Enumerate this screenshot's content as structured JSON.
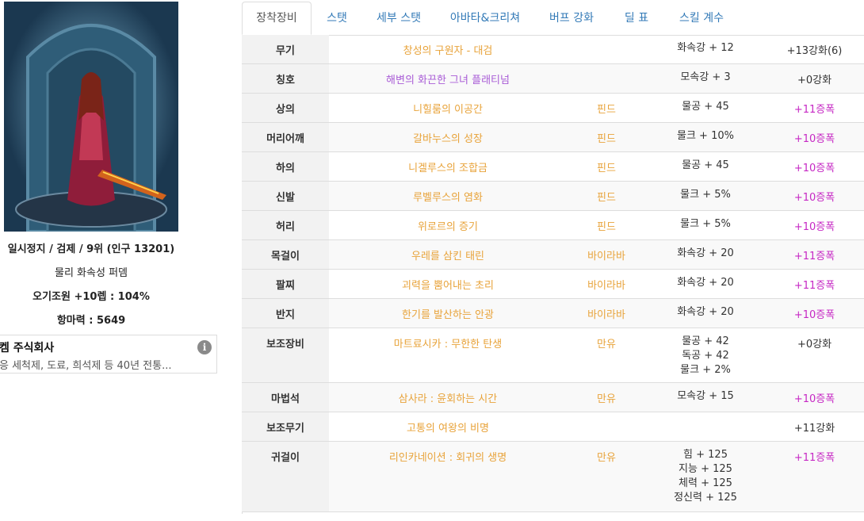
{
  "character": {
    "status_line": "일시정지 / 검제 / 9위 (인구 13201)",
    "element_line": "물리 화속성 퍼뎀",
    "buff_line": "오기조원 +10렙 : 104%",
    "resist_line": "항마력 : 5649"
  },
  "ad": {
    "title": "켐 주식회사",
    "description": "응 세척제, 도료, 희석제 등 40년 전통...",
    "info_icon": "i"
  },
  "tabs": [
    "장착장비",
    "스탯",
    "세부 스탯",
    "아바타&크리쳐",
    "버프 강화",
    "딜 표",
    "스킬 계수"
  ],
  "equipment": [
    {
      "slot": "무기",
      "name": "창성의 구원자 - 대검",
      "name_color": "orange",
      "grade": "",
      "stats": [
        "화속강 + 12"
      ],
      "upgrade": "+13강화(6)",
      "amp": false
    },
    {
      "slot": "칭호",
      "name": "해변의 화끈한 그녀 플래티넘",
      "name_color": "purple",
      "grade": "",
      "stats": [
        "모속강 + 3"
      ],
      "upgrade": "+0강화",
      "amp": false
    },
    {
      "slot": "상의",
      "name": "니힐룸의 이공간",
      "name_color": "orange",
      "grade": "핀드",
      "stats": [
        "물공 + 45"
      ],
      "upgrade": "+11증폭",
      "amp": true
    },
    {
      "slot": "머리어깨",
      "name": "갈바누스의 성장",
      "name_color": "orange",
      "grade": "핀드",
      "stats": [
        "물크 + 10%"
      ],
      "upgrade": "+10증폭",
      "amp": true
    },
    {
      "slot": "하의",
      "name": "니겔루스의 조합금",
      "name_color": "orange",
      "grade": "핀드",
      "stats": [
        "물공 + 45"
      ],
      "upgrade": "+10증폭",
      "amp": true
    },
    {
      "slot": "신발",
      "name": "루벨루스의 염화",
      "name_color": "orange",
      "grade": "핀드",
      "stats": [
        "물크 + 5%"
      ],
      "upgrade": "+10증폭",
      "amp": true
    },
    {
      "slot": "허리",
      "name": "위로르의 증기",
      "name_color": "orange",
      "grade": "핀드",
      "stats": [
        "물크 + 5%"
      ],
      "upgrade": "+10증폭",
      "amp": true
    },
    {
      "slot": "목걸이",
      "name": "우레를 삼킨 태린",
      "name_color": "orange",
      "grade": "바이라바",
      "stats": [
        "화속강 + 20"
      ],
      "upgrade": "+11증폭",
      "amp": true
    },
    {
      "slot": "팔찌",
      "name": "괴력을 뿜어내는 초리",
      "name_color": "orange",
      "grade": "바이라바",
      "stats": [
        "화속강 + 20"
      ],
      "upgrade": "+11증폭",
      "amp": true
    },
    {
      "slot": "반지",
      "name": "한기를 발산하는 안광",
      "name_color": "orange",
      "grade": "바이라바",
      "stats": [
        "화속강 + 20"
      ],
      "upgrade": "+10증폭",
      "amp": true
    },
    {
      "slot": "보조장비",
      "name": "마트료시카 : 무한한 탄생",
      "name_color": "orange",
      "grade": "만유",
      "stats": [
        "물공 + 42",
        "독공 + 42",
        "물크 + 2%"
      ],
      "upgrade": "+0강화",
      "amp": false
    },
    {
      "slot": "마법석",
      "name": "삼사라 : 윤회하는 시간",
      "name_color": "orange",
      "grade": "만유",
      "stats": [
        "모속강 + 15"
      ],
      "upgrade": "+10증폭",
      "amp": true
    },
    {
      "slot": "보조무기",
      "name": "고통의 여왕의 비명",
      "name_color": "orange",
      "grade": "",
      "stats": [],
      "upgrade": "+11강화",
      "amp": false
    },
    {
      "slot": "귀걸이",
      "name": "리인카네이션 : 회귀의 생명",
      "name_color": "orange",
      "grade": "만유",
      "stats": [
        "힘 + 125",
        "지능 + 125",
        "체력 + 125",
        "정신력 + 125"
      ],
      "upgrade": "+11증폭",
      "amp": true
    }
  ],
  "colors": {
    "item_orange": "#e8a33a",
    "item_purple": "#a85bd6",
    "amp_magenta": "#c628c4",
    "tab_link": "#337ab7"
  }
}
